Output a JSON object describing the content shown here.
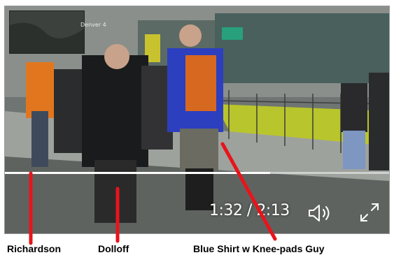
{
  "video": {
    "pip_label": "Denver 4",
    "current_time": "1:32",
    "separator": " / ",
    "duration": "2:13",
    "progress": 0.69
  },
  "annotations": {
    "richardson": "Richardson",
    "dolloff": "Dolloff",
    "blue_shirt": "Blue Shirt w Knee-pads Guy",
    "arrow_color": "#e8141b"
  },
  "icons": {
    "volume": "speaker-icon",
    "fullscreen": "expand-icon"
  }
}
